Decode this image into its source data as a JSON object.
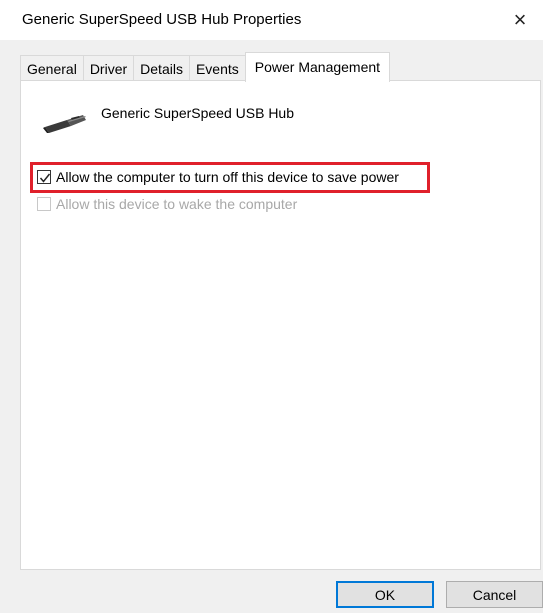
{
  "window": {
    "title": "Generic SuperSpeed USB Hub Properties",
    "close_glyph": "×"
  },
  "tabs": [
    {
      "label": "General",
      "active": false
    },
    {
      "label": "Driver",
      "active": false
    },
    {
      "label": "Details",
      "active": false
    },
    {
      "label": "Events",
      "active": false
    },
    {
      "label": "Power Management",
      "active": true
    }
  ],
  "device": {
    "name": "Generic SuperSpeed USB Hub",
    "icon": "usb-plug-icon"
  },
  "options": [
    {
      "label": "Allow the computer to turn off this device to save power",
      "checked": true,
      "enabled": true,
      "highlighted": true
    },
    {
      "label": "Allow this device to wake the computer",
      "checked": false,
      "enabled": false,
      "highlighted": false
    }
  ],
  "buttons": {
    "ok": "OK",
    "cancel": "Cancel"
  },
  "colors": {
    "highlight": "#e0202b",
    "default_button_border": "#0078d7"
  }
}
